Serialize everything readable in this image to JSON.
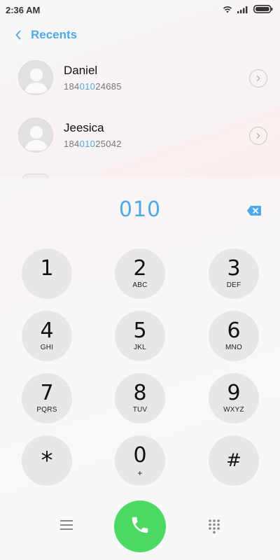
{
  "status_bar": {
    "time": "2:36 AM",
    "icons": [
      "wifi-icon",
      "signal-icon",
      "battery-icon"
    ]
  },
  "header": {
    "back_icon": "chevron-left-icon",
    "title": "Recents"
  },
  "recents": [
    {
      "name": "Daniel",
      "number_prefix": "184",
      "number_match": "010",
      "number_suffix": "24685"
    },
    {
      "name": "Jeesica",
      "number_prefix": "184",
      "number_match": "010",
      "number_suffix": "25042"
    }
  ],
  "dialer": {
    "dialed_number": "010",
    "keys": [
      {
        "digit": "1",
        "letters": ""
      },
      {
        "digit": "2",
        "letters": "ABC"
      },
      {
        "digit": "3",
        "letters": "DEF"
      },
      {
        "digit": "4",
        "letters": "GHI"
      },
      {
        "digit": "5",
        "letters": "JKL"
      },
      {
        "digit": "6",
        "letters": "MNO"
      },
      {
        "digit": "7",
        "letters": "PQRS"
      },
      {
        "digit": "8",
        "letters": "TUV"
      },
      {
        "digit": "9",
        "letters": "WXYZ"
      },
      {
        "digit": "*",
        "letters": ""
      },
      {
        "digit": "0",
        "letters": "+"
      },
      {
        "digit": "#",
        "letters": ""
      }
    ]
  },
  "colors": {
    "accent": "#4fa9e6",
    "call_green": "#4cd964",
    "key_background": "#e7e7e7"
  }
}
